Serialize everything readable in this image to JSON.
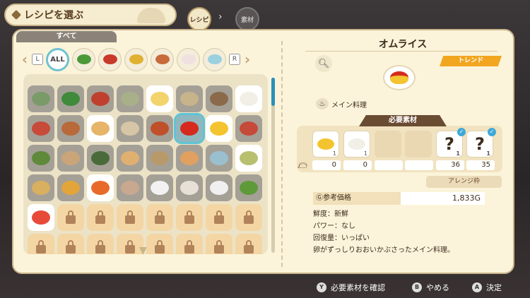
{
  "header": {
    "title": "レシピを選ぶ",
    "crumb_recipe": "レシピ",
    "crumb_material": "素材"
  },
  "recipe_list": {
    "tab_label": "すべて",
    "left_key": "L",
    "right_key": "R",
    "categories": [
      "ALL",
      "salad",
      "soup-red",
      "soup-yellow",
      "main-dish",
      "cake",
      "drink"
    ],
    "active_category": "ALL",
    "cells": [
      {
        "state": "got",
        "color": "#7a9a6a"
      },
      {
        "state": "got",
        "color": "#3f8a3b"
      },
      {
        "state": "got",
        "color": "#c0402f"
      },
      {
        "state": "got",
        "color": "#a8b08a"
      },
      {
        "state": "new",
        "color": "#f3d36b"
      },
      {
        "state": "got",
        "color": "#c8b48a"
      },
      {
        "state": "got",
        "color": "#8a6a4a"
      },
      {
        "state": "new",
        "color": "#f2efe6"
      },
      {
        "state": "got",
        "color": "#c74a3a"
      },
      {
        "state": "got",
        "color": "#b86a3a"
      },
      {
        "state": "new",
        "color": "#e6b56a"
      },
      {
        "state": "got",
        "color": "#d6c6a6"
      },
      {
        "state": "got",
        "color": "#c0502a"
      },
      {
        "state": "sel",
        "color": "#d62a1e"
      },
      {
        "state": "new",
        "color": "#f4c430"
      },
      {
        "state": "got",
        "color": "#c64a3a"
      },
      {
        "state": "got",
        "color": "#5f8a3a"
      },
      {
        "state": "got",
        "color": "#caa57a"
      },
      {
        "state": "got",
        "color": "#4a6a3a"
      },
      {
        "state": "got",
        "color": "#e0b070"
      },
      {
        "state": "got",
        "color": "#b89a6a"
      },
      {
        "state": "got",
        "color": "#e0a060"
      },
      {
        "state": "got",
        "color": "#9ac0d0"
      },
      {
        "state": "new",
        "color": "#b8c070"
      },
      {
        "state": "got",
        "color": "#d9b060"
      },
      {
        "state": "got",
        "color": "#e3a43a"
      },
      {
        "state": "new",
        "color": "#e86a2a"
      },
      {
        "state": "got",
        "color": "#c9a890"
      },
      {
        "state": "got",
        "color": "#f2f2f2"
      },
      {
        "state": "got",
        "color": "#e6e0d6"
      },
      {
        "state": "got",
        "color": "#f0f0f0"
      },
      {
        "state": "got",
        "color": "#5f9a3a"
      },
      {
        "state": "new",
        "color": "#e84a3a"
      },
      {
        "state": "lock"
      },
      {
        "state": "lock"
      },
      {
        "state": "lock"
      },
      {
        "state": "lock"
      },
      {
        "state": "lock"
      },
      {
        "state": "lock"
      },
      {
        "state": "lock"
      },
      {
        "state": "lock"
      },
      {
        "state": "lock"
      },
      {
        "state": "lock"
      },
      {
        "state": "lock"
      },
      {
        "state": "lock"
      },
      {
        "state": "lock"
      },
      {
        "state": "lock"
      },
      {
        "state": "lock"
      }
    ]
  },
  "detail": {
    "dish_name": "オムライス",
    "badge": "トレンド",
    "type": "メイン料理",
    "required_header": "必要素材",
    "ingredients": [
      {
        "kind": "filled",
        "color": "#f4c430",
        "count": "1",
        "owned": "0"
      },
      {
        "kind": "filled",
        "color": "#f2efe6",
        "count": "1",
        "owned": "0"
      },
      {
        "kind": "empty",
        "count": "",
        "owned": ""
      },
      {
        "kind": "empty",
        "count": "",
        "owned": ""
      },
      {
        "kind": "q",
        "count": "1",
        "owned": "36",
        "check": true
      },
      {
        "kind": "q",
        "count": "1",
        "owned": "35",
        "check": true
      }
    ],
    "arrange_label": "アレンジ枠",
    "price_label": "Ⓖ参考価格",
    "price_value": "1,833G",
    "freshness": "鮮度：新鮮",
    "power": "パワー：なし",
    "recovery": "回復量：いっぱい",
    "description": "卵がずっしりおおいかぶさったメイン料理。"
  },
  "footer": {
    "y_key": "Y",
    "y_label": "必要素材を確認",
    "b_key": "B",
    "b_label": "やめる",
    "a_key": "A",
    "a_label": "決定"
  }
}
